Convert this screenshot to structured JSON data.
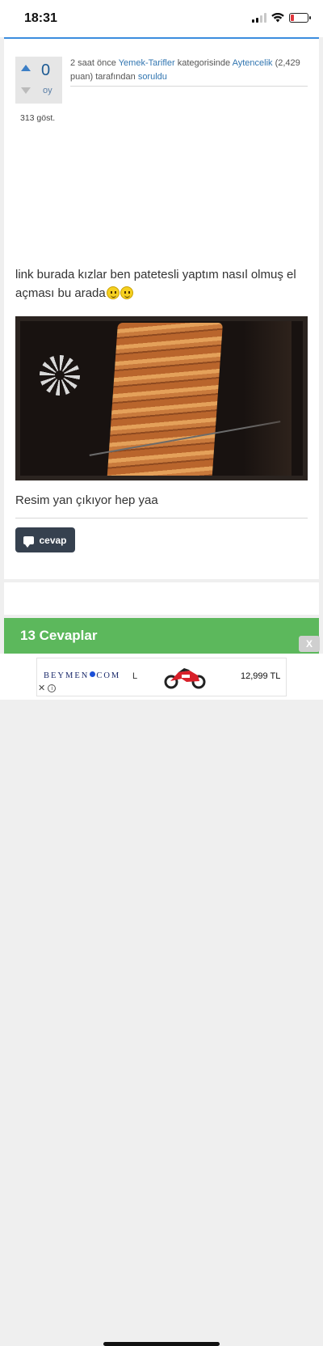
{
  "status_bar": {
    "time": "18:31"
  },
  "question": {
    "votes": "0",
    "vote_label": "oy",
    "meta": {
      "time_ago": "2 saat önce",
      "category": "Yemek-Tarifler",
      "category_suffix": "kategorisinde",
      "author": "Aytencelik",
      "points": "(2,429 puan)",
      "by_text": "tarafından",
      "action": "soruldu"
    },
    "views": "313 göst.",
    "text": "link burada kızlar ben patetesli yaptım nasıl olmuş el açması bu arada",
    "image_caption": "Resim yan çıkıyor hep yaa",
    "reply_label": "cevap"
  },
  "answers": {
    "title": "13 Cevaplar"
  },
  "ad": {
    "close_label": "X",
    "brand": "BEYMEN",
    "brand_suffix": "COM",
    "size_letter": "L",
    "price": "12,999 TL"
  },
  "colors": {
    "accent": "#3c8dde",
    "link": "#3276b1",
    "answers_bar": "#5cb85c",
    "reply_button": "#36414f"
  }
}
